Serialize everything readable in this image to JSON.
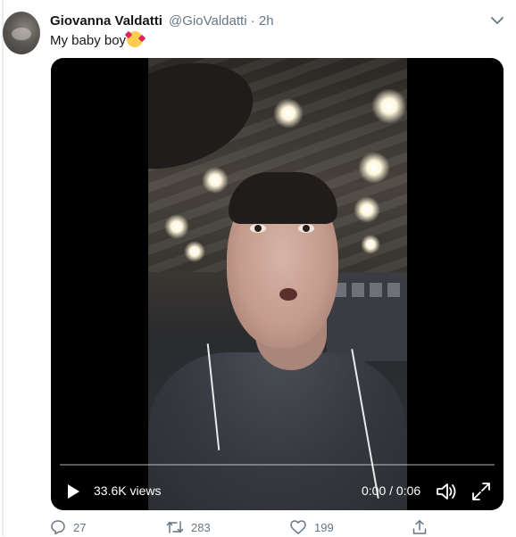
{
  "tweet": {
    "author_name": "Giovanna Valdatti",
    "handle": "@GioValdatti",
    "separator": "·",
    "time": "2h",
    "text": "My baby boy",
    "emoji": "smiling-face-with-hearts"
  },
  "video": {
    "views": "33.6K views",
    "time_readout": "0:00 / 0:06",
    "progress": 0.0,
    "icons": [
      "play-icon",
      "volume-icon",
      "fullscreen-icon"
    ]
  },
  "actions": {
    "reply_count": "27",
    "retweet_count": "283",
    "like_count": "199"
  },
  "colors": {
    "secondary_text": "#657786",
    "primary_text": "#14171a",
    "video_bg": "#000000"
  }
}
